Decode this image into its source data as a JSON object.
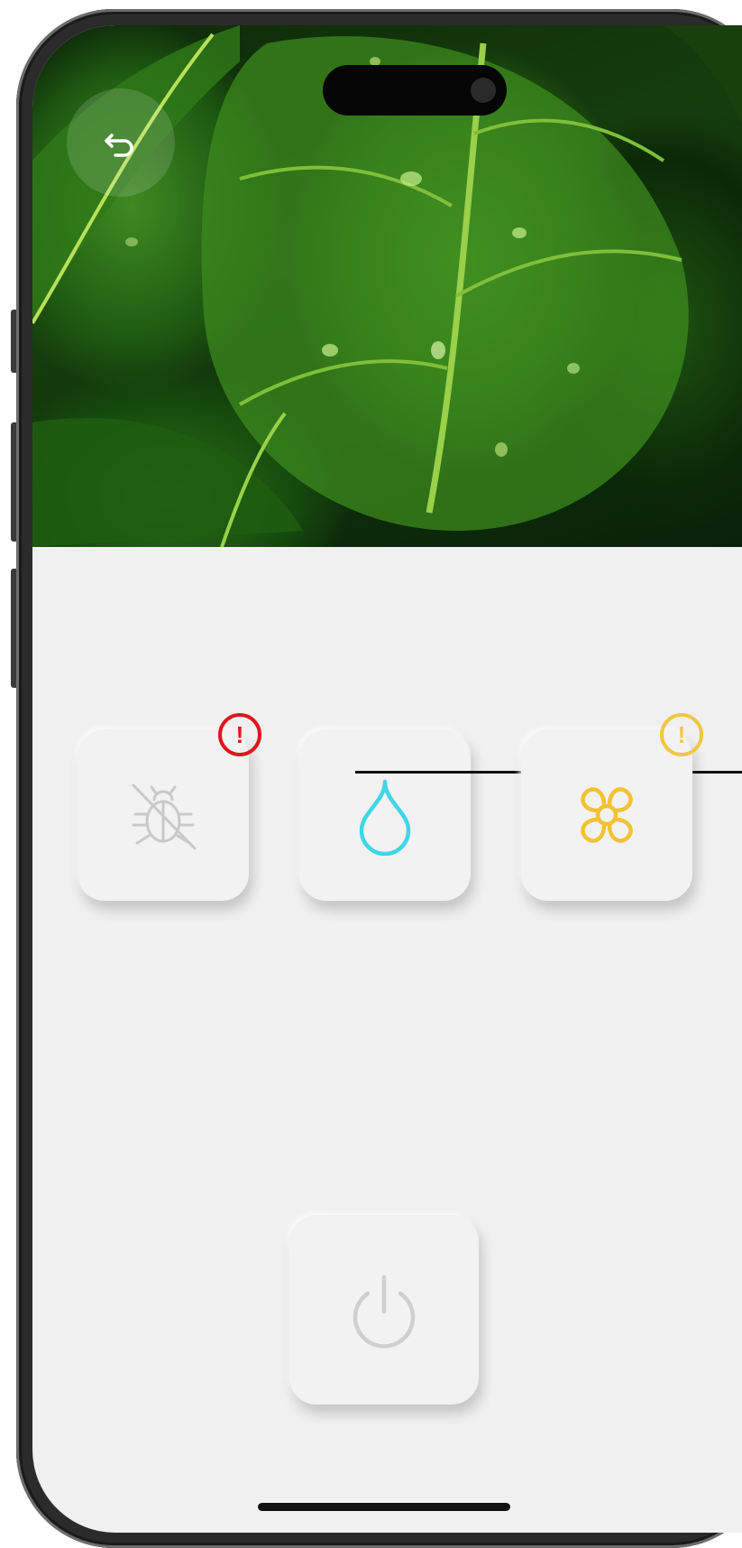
{
  "colors": {
    "screen_background": "#f0f0f0",
    "tile_background": "#f2f2f2",
    "pest_icon": "#c9c9c9",
    "water_icon": "#3fd6e6",
    "flower_icon": "#f2c233",
    "alert_red": "#e0151c",
    "alert_yellow": "#f2c233",
    "power_icon": "#cfcfcf"
  },
  "icons": {
    "back": "undo-arrow-icon",
    "pests": "bug-off-icon",
    "water": "water-drop-icon",
    "flower": "flower-icon",
    "power": "power-icon",
    "alert": "exclamation-circle-icon"
  },
  "alerts": {
    "pests_badge": "!",
    "flower_badge": "!"
  }
}
